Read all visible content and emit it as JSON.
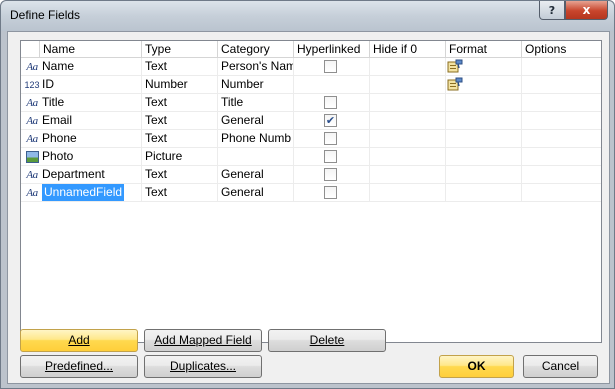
{
  "window": {
    "title": "Define Fields",
    "help_label": "?",
    "close_label": "x"
  },
  "grid": {
    "columns": [
      "Name",
      "Type",
      "Category",
      "Hyperlinked",
      "Hide if 0",
      "Format",
      "Options"
    ],
    "rows": [
      {
        "icon": "text-field-icon",
        "icon_label": "Aa",
        "name": "Name",
        "type": "Text",
        "category": "Person's Nam",
        "hyperlinked": false,
        "hyperlink_box": true,
        "format_icon": true
      },
      {
        "icon": "number-field-icon",
        "icon_label": "123",
        "name": "ID",
        "type": "Number",
        "category": "Number",
        "hyperlinked": false,
        "hyperlink_box": false,
        "format_icon": true
      },
      {
        "icon": "text-field-icon",
        "icon_label": "Aa",
        "name": "Title",
        "type": "Text",
        "category": "Title",
        "hyperlinked": false,
        "hyperlink_box": true,
        "format_icon": false
      },
      {
        "icon": "text-field-icon",
        "icon_label": "Aa",
        "name": "Email",
        "type": "Text",
        "category": "General",
        "hyperlinked": true,
        "hyperlink_box": true,
        "format_icon": false
      },
      {
        "icon": "text-field-icon",
        "icon_label": "Aa",
        "name": "Phone",
        "type": "Text",
        "category": "Phone Numb",
        "hyperlinked": false,
        "hyperlink_box": true,
        "format_icon": false
      },
      {
        "icon": "picture-field-icon",
        "icon_label": "",
        "name": "Photo",
        "type": "Picture",
        "category": "",
        "hyperlinked": false,
        "hyperlink_box": true,
        "format_icon": false
      },
      {
        "icon": "text-field-icon",
        "icon_label": "Aa",
        "name": "Department",
        "type": "Text",
        "category": "General",
        "hyperlinked": false,
        "hyperlink_box": true,
        "format_icon": false
      },
      {
        "icon": "text-field-icon",
        "icon_label": "Aa",
        "name": "UnnamedField",
        "type": "Text",
        "category": "General",
        "hyperlinked": false,
        "hyperlink_box": true,
        "format_icon": false,
        "selected": true
      }
    ]
  },
  "buttons": {
    "add": "Add",
    "add_mapped_field": "Add Mapped Field",
    "delete": "Delete",
    "predefined": "Predefined...",
    "duplicates": "Duplicates...",
    "ok": "OK",
    "cancel": "Cancel"
  },
  "colors": {
    "selection": "#3399ff",
    "primary_button": "#ffd94f",
    "checkmark": "#2b4f8c"
  }
}
